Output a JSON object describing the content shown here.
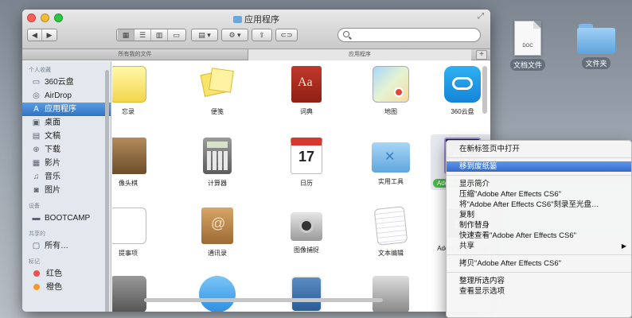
{
  "window": {
    "title": "应用程序"
  },
  "tabs": [
    {
      "label": "所有我的文件"
    },
    {
      "label": "应用程序"
    }
  ],
  "search": {
    "value": "",
    "placeholder": ""
  },
  "sidebar": {
    "sections": [
      {
        "header": "个人收藏",
        "items": [
          {
            "label": "360云盘",
            "icon": "drive-icon"
          },
          {
            "label": "AirDrop",
            "icon": "airdrop-icon"
          },
          {
            "label": "应用程序",
            "icon": "applications-icon",
            "selected": true
          },
          {
            "label": "桌面",
            "icon": "desktop-icon"
          },
          {
            "label": "文稿",
            "icon": "documents-icon"
          },
          {
            "label": "下载",
            "icon": "downloads-icon"
          },
          {
            "label": "影片",
            "icon": "movies-icon"
          },
          {
            "label": "音乐",
            "icon": "music-icon"
          },
          {
            "label": "图片",
            "icon": "pictures-icon"
          }
        ]
      },
      {
        "header": "设备",
        "items": [
          {
            "label": "BOOTCAMP",
            "icon": "disk-icon"
          }
        ]
      },
      {
        "header": "共享的",
        "items": [
          {
            "label": "所有…",
            "icon": "network-icon"
          }
        ]
      },
      {
        "header": "标记",
        "items": [
          {
            "label": "红色",
            "color": "#f0504a"
          },
          {
            "label": "橙色",
            "color": "#f39a2c"
          }
        ]
      }
    ]
  },
  "apps": {
    "row1": [
      "忘录",
      "便笺",
      "词典",
      "地图",
      "360云盘"
    ],
    "row2": [
      "像头棋",
      "计算器",
      "日历",
      "实用工具",
      "Adobe After Effects CS6"
    ],
    "row3": [
      "提事项",
      "通讯录",
      "图像捕捉",
      "文本编辑",
      "Adobe Photoshop Lightroom"
    ],
    "calendar_day": "17",
    "ae_label": "Ae",
    "lr_label": "Lr",
    "dict_label": "Aa"
  },
  "context_menu": {
    "items": [
      {
        "label": "在新标签页中打开"
      },
      {
        "sep": true
      },
      {
        "label": "移到废纸篓",
        "highlighted": true
      },
      {
        "sep": true
      },
      {
        "label": "显示简介"
      },
      {
        "label": "压缩\"Adobe After Effects CS6\""
      },
      {
        "label": "将\"Adobe After Effects CS6\"刻录至光盘…"
      },
      {
        "label": "复制"
      },
      {
        "label": "制作替身"
      },
      {
        "label": "快速查看\"Adobe After Effects CS6\""
      },
      {
        "label": "共享",
        "submenu": true
      },
      {
        "sep": true
      },
      {
        "label": "拷贝\"Adobe After Effects CS6\""
      },
      {
        "sep": true
      },
      {
        "label": "整理所选内容"
      },
      {
        "label": "查看显示选项"
      }
    ]
  },
  "desktop": {
    "doc_label": "DOC",
    "icons": [
      {
        "label": "文档文件"
      },
      {
        "label": "文件夹"
      }
    ]
  },
  "colors": {
    "selection": "#3a7fd0",
    "tag_red": "#f0504a",
    "tag_orange": "#f39a2c"
  }
}
